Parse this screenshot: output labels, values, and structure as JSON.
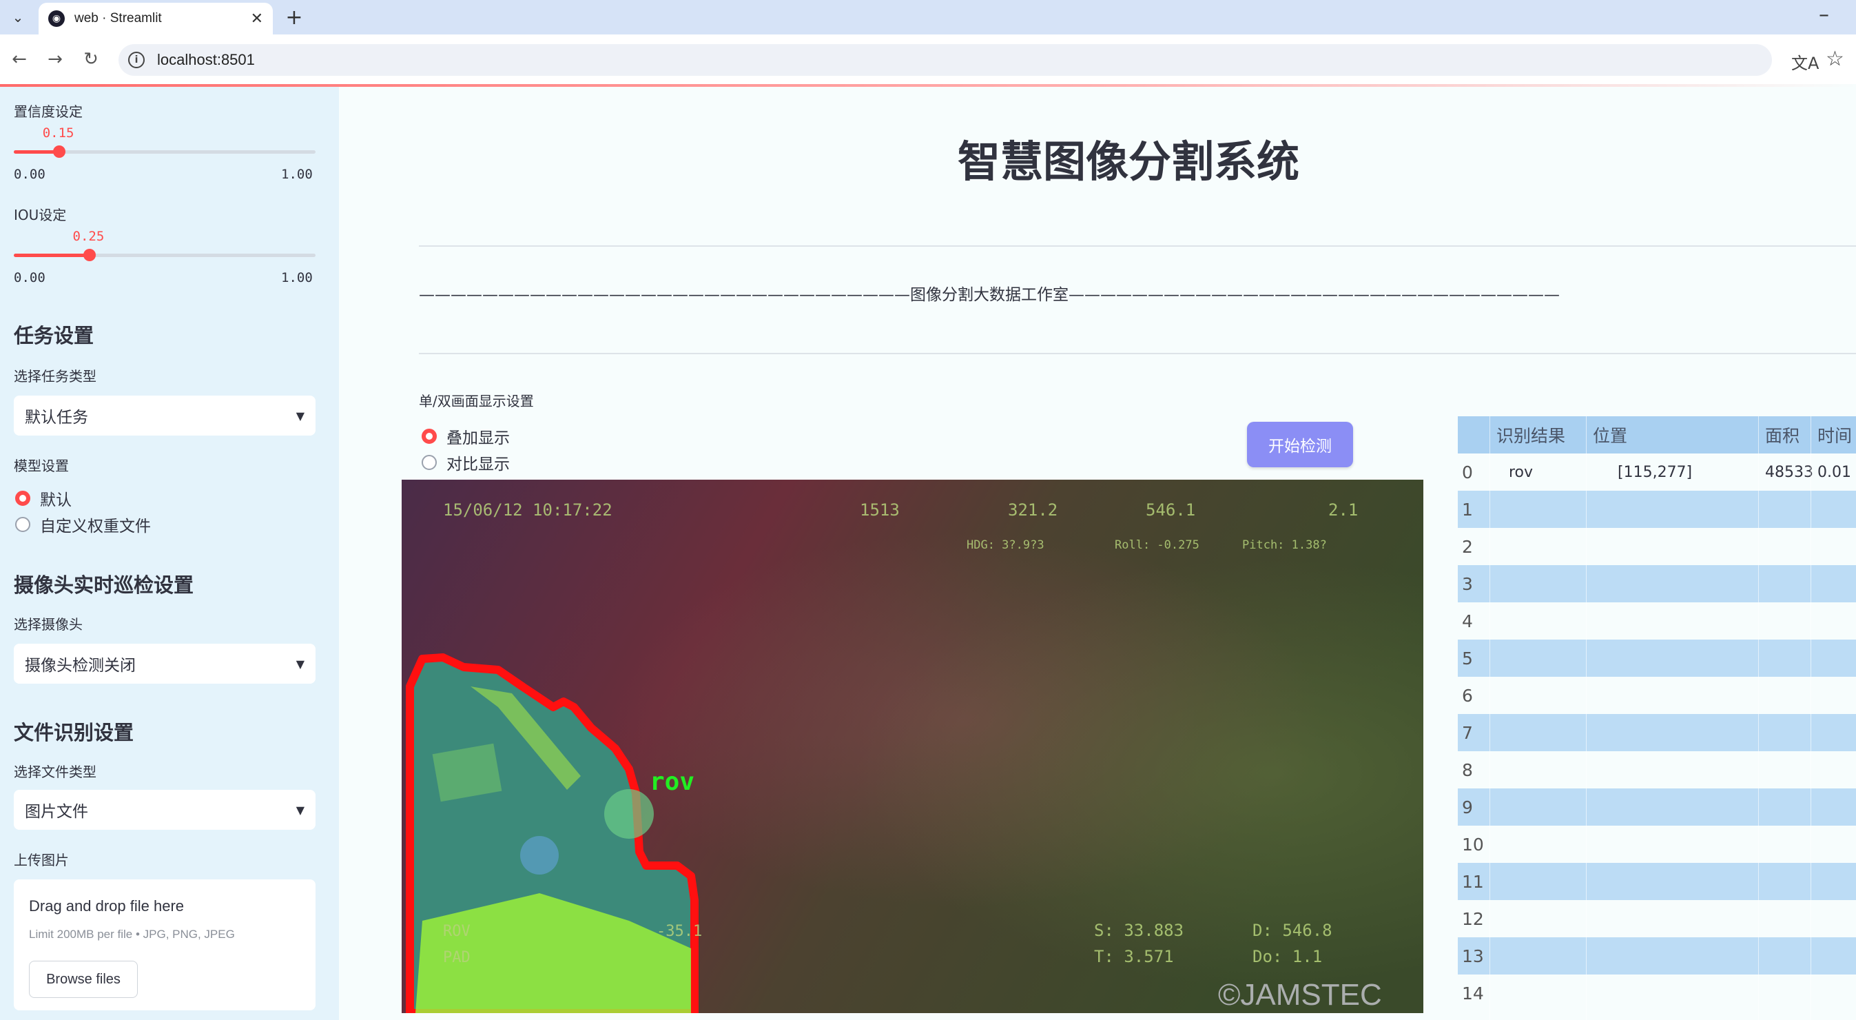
{
  "browser": {
    "tab_title": "web · Streamlit",
    "url": "localhost:8501"
  },
  "sidebar": {
    "confidence": {
      "label": "置信度设定",
      "value": 0.15,
      "value_text": "0.15",
      "min": "0.00",
      "max": "1.00"
    },
    "iou": {
      "label": "IOU设定",
      "value": 0.25,
      "value_text": "0.25",
      "min": "0.00",
      "max": "1.00"
    },
    "task_heading": "任务设置",
    "task_type_label": "选择任务类型",
    "task_type_value": "默认任务",
    "model_label": "模型设置",
    "model_options": [
      "默认",
      "自定义权重文件"
    ],
    "camera_heading": "摄像头实时巡检设置",
    "camera_label": "选择摄像头",
    "camera_value": "摄像头检测关闭",
    "file_heading": "文件识别设置",
    "file_type_label": "选择文件类型",
    "file_type_value": "图片文件",
    "upload_label": "上传图片",
    "upload": {
      "title": "Drag and drop file here",
      "limit": "Limit 200MB per file • JPG, PNG, JPEG",
      "button": "Browse files"
    }
  },
  "main": {
    "title": "智慧图像分割系统",
    "studio": "———————————————————————————————图像分割大数据工作室———————————————————————————————",
    "display_label": "单/双画面显示设置",
    "display_options": [
      "叠加显示",
      "对比显示"
    ],
    "start_button": "开始检测"
  },
  "image": {
    "timestamp": "15/06/12  10:17:22",
    "hud_top": [
      "1513",
      "321.2",
      "546.1",
      "2.1"
    ],
    "hud_mid": [
      "HDG: 3?.9?3",
      "Roll: -0.275",
      "Pitch: 1.38?"
    ],
    "hud_bottom_left": [
      "ROV",
      "-35.1",
      "PAD"
    ],
    "hud_bottom_right": [
      "S: 33.883",
      "D: 546.8",
      "T: 3.571",
      "Do: 1.1"
    ],
    "watermark": "©JAMSTEC",
    "detection_label": "rov",
    "mask_color": "#ff0000",
    "label_color": "#22ee22"
  },
  "table": {
    "headers": [
      "识别结果",
      "位置",
      "面积",
      "时间"
    ],
    "rows": [
      {
        "index": "0",
        "result": "rov",
        "position": "[115,277]",
        "area": "48533",
        "time": "0.01"
      },
      {
        "index": "1",
        "result": "",
        "position": "",
        "area": "",
        "time": ""
      },
      {
        "index": "2",
        "result": "",
        "position": "",
        "area": "",
        "time": ""
      },
      {
        "index": "3",
        "result": "",
        "position": "",
        "area": "",
        "time": ""
      },
      {
        "index": "4",
        "result": "",
        "position": "",
        "area": "",
        "time": ""
      },
      {
        "index": "5",
        "result": "",
        "position": "",
        "area": "",
        "time": ""
      },
      {
        "index": "6",
        "result": "",
        "position": "",
        "area": "",
        "time": ""
      },
      {
        "index": "7",
        "result": "",
        "position": "",
        "area": "",
        "time": ""
      },
      {
        "index": "8",
        "result": "",
        "position": "",
        "area": "",
        "time": ""
      },
      {
        "index": "9",
        "result": "",
        "position": "",
        "area": "",
        "time": ""
      },
      {
        "index": "10",
        "result": "",
        "position": "",
        "area": "",
        "time": ""
      },
      {
        "index": "11",
        "result": "",
        "position": "",
        "area": "",
        "time": ""
      },
      {
        "index": "12",
        "result": "",
        "position": "",
        "area": "",
        "time": ""
      },
      {
        "index": "13",
        "result": "",
        "position": "",
        "area": "",
        "time": ""
      },
      {
        "index": "14",
        "result": "",
        "position": "",
        "area": "",
        "time": ""
      }
    ]
  },
  "colors": {
    "accent": "#ff4b4b",
    "button": "#8b8ef5",
    "sidebar_bg": "#e4f3fb",
    "table_header": "#a9d0f1",
    "table_alt": "#bcdcf5"
  }
}
